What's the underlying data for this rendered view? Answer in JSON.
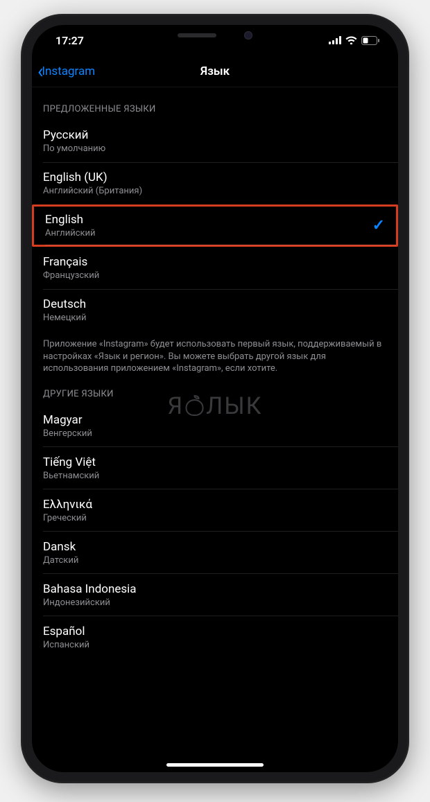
{
  "status_bar": {
    "time": "17:27"
  },
  "nav": {
    "back_label": "Instagram",
    "title": "Язык"
  },
  "sections": {
    "suggested_header": "ПРЕДЛОЖЕННЫЕ ЯЗЫКИ",
    "other_header": "ДРУГИЕ ЯЗЫКИ",
    "footer": "Приложение «Instagram» будет использовать первый язык, поддерживаемый в настройках «Язык и регион». Вы можете выбрать другой язык для использования приложением «Instagram», если хотите."
  },
  "suggested": [
    {
      "title": "Русский",
      "subtitle": "По умолчанию",
      "selected": false
    },
    {
      "title": "English (UK)",
      "subtitle": "Английский (Британия)",
      "selected": false
    },
    {
      "title": "English",
      "subtitle": "Английский",
      "selected": true,
      "highlighted": true
    },
    {
      "title": "Français",
      "subtitle": "Французский",
      "selected": false
    },
    {
      "title": "Deutsch",
      "subtitle": "Немецкий",
      "selected": false
    }
  ],
  "other": [
    {
      "title": "Magyar",
      "subtitle": "Венгерский"
    },
    {
      "title": "Tiếng Việt",
      "subtitle": "Вьетнамский"
    },
    {
      "title": "Ελληνικά",
      "subtitle": "Греческий"
    },
    {
      "title": "Dansk",
      "subtitle": "Датский"
    },
    {
      "title": "Bahasa Indonesia",
      "subtitle": "Индонезийский"
    },
    {
      "title": "Español",
      "subtitle": "Испанский"
    }
  ],
  "watermark": {
    "text_before": "Я",
    "text_after": "ЛЫК"
  },
  "colors": {
    "accent": "#0a84ff",
    "highlight_border": "#d63c1f",
    "bg": "#000000",
    "text_primary": "#ffffff",
    "text_secondary": "#8e8e93"
  }
}
